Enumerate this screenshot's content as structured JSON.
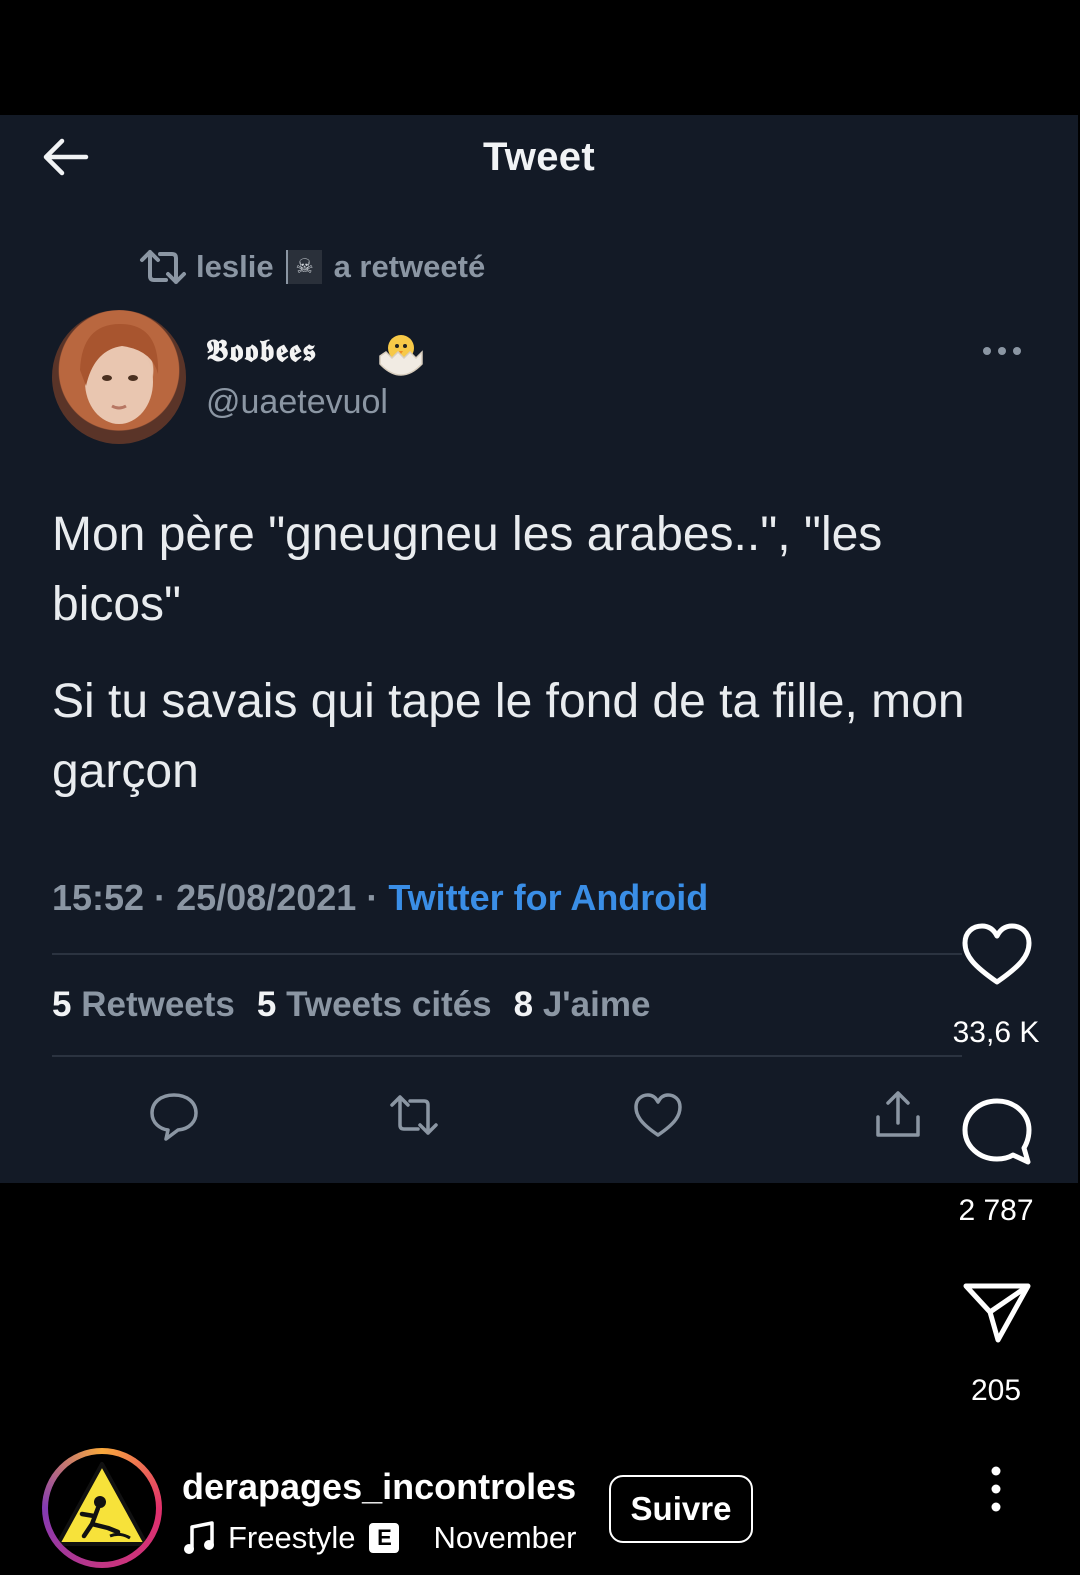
{
  "tweet": {
    "header_title": "Tweet",
    "retweeted_by": "leslie",
    "retweeted_suffix": "a retweeté",
    "flag_glyph": "☠",
    "author_display_name": "𝕭𝖔𝖔𝖇𝖊𝖊𝖘",
    "author_handle": "@uaetevuol",
    "text_paragraph_1": "Mon père \"gneugneu les arabes..\", \"les bicos\"",
    "text_paragraph_2": "Si tu savais qui tape le fond de ta fille, mon garçon",
    "time": "15:52",
    "date": "25/08/2021",
    "source": "Twitter for Android",
    "separator": "·",
    "stats": {
      "retweets_count": "5",
      "retweets_label": "Retweets",
      "quotes_count": "5",
      "quotes_label": "Tweets cités",
      "likes_count": "8",
      "likes_label": "J'aime"
    }
  },
  "sidebar": {
    "likes_count": "33,6 K",
    "comments_count": "2 787",
    "shares_count": "205"
  },
  "account": {
    "username": "derapages_incontroles",
    "follow_label": "Suivre",
    "music_title": "Freestyle",
    "explicit_badge": "E",
    "music_artist_partial": "November"
  },
  "colors": {
    "tweet_background": "#131a26",
    "secondary_text": "#8b96a3",
    "link_blue": "#3a8ee6",
    "app_background": "#000000"
  }
}
